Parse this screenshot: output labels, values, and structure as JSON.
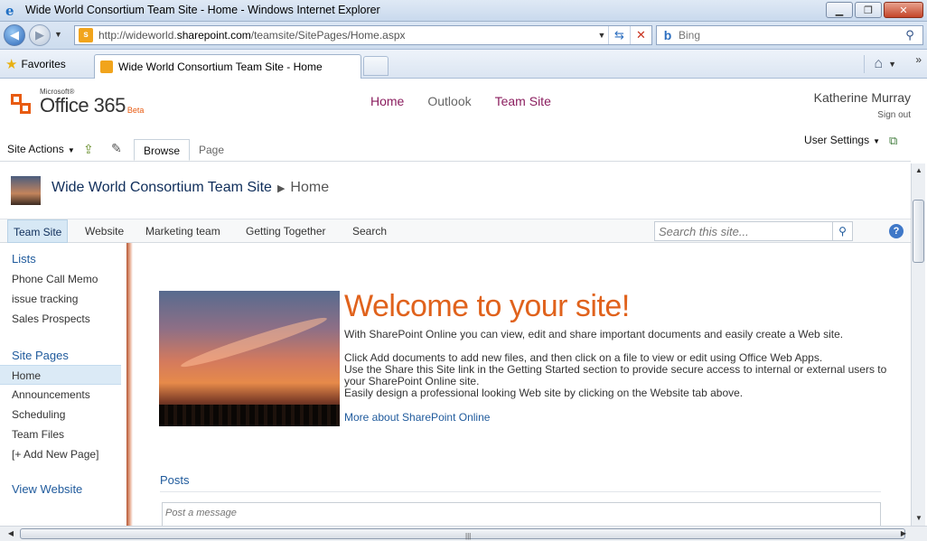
{
  "window": {
    "title": "Wide World Consortium Team Site - Home - Windows Internet Explorer",
    "minimize": "▁",
    "restore": "❐",
    "close": "✕"
  },
  "address": {
    "url_pre": "http://wideworld.",
    "url_host": "sharepoint.com",
    "url_post": "/teamsite/SitePages/Home.aspx"
  },
  "search": {
    "placeholder": "Bing"
  },
  "favorites": {
    "label": "Favorites"
  },
  "tab": {
    "title": "Wide World Consortium Team Site - Home"
  },
  "header": {
    "brand_ms": "Microsoft®",
    "brand_word": "Office 365",
    "brand_beta": "Beta",
    "nav": [
      "Home",
      "Outlook",
      "Team Site"
    ],
    "user": "Katherine Murray",
    "sign_out": "Sign out"
  },
  "ribbon": {
    "site_actions": "Site Actions",
    "browse": "Browse",
    "page": "Page",
    "user_settings": "User Settings"
  },
  "breadcrumb": {
    "site": "Wide World Consortium Team Site",
    "current": "Home"
  },
  "topnav": {
    "items": [
      "Team Site",
      "Website",
      "Marketing team",
      "Getting Together",
      "Search"
    ],
    "search_placeholder": "Search this site..."
  },
  "leftnav": {
    "lists_header": "Lists",
    "lists": [
      "Phone Call Memo",
      "issue tracking",
      "Sales Prospects"
    ],
    "pages_header": "Site Pages",
    "pages": [
      "Home",
      "Announcements",
      "Scheduling",
      "Team Files",
      "[+ Add New Page]"
    ],
    "view_website": "View Website"
  },
  "welcome": {
    "heading": "Welcome to your site!",
    "p1": "With SharePoint Online you can view, edit and share important documents and easily create a Web site.",
    "p2a": "Click Add documents to add new files, and then click on a file to view or edit using Office Web Apps.",
    "p2b": "Use the Share this Site link in the Getting Started section to provide secure access to internal or external users to your SharePoint Online site.",
    "p2c": "Easily design a professional looking Web site by clicking on the Website tab above.",
    "more_link": "More about SharePoint Online"
  },
  "posts": {
    "header": "Posts",
    "placeholder": "Post a message"
  },
  "colors": {
    "accent_orange": "#e0621c",
    "link_blue": "#1f5a9c",
    "nav_magenta": "#8b1e5f"
  }
}
